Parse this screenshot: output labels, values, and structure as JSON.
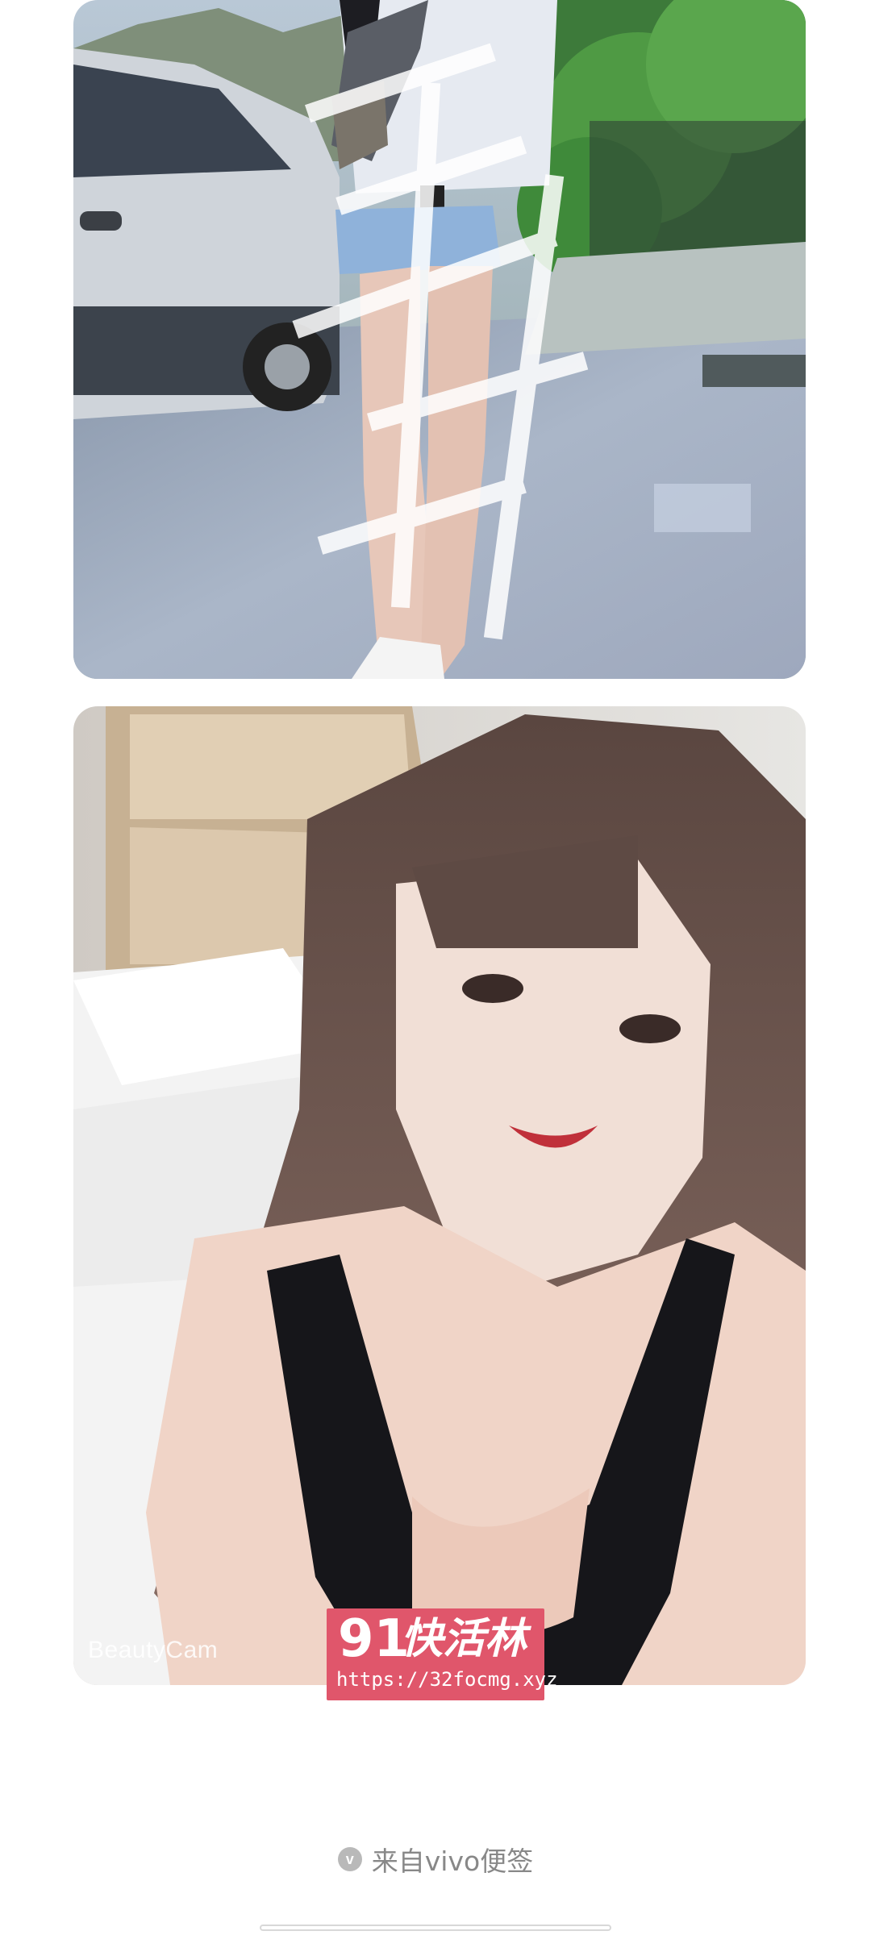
{
  "photos": [
    {
      "id": "street-photo",
      "watermark": ""
    },
    {
      "id": "selfie-photo",
      "watermark": "BeautyCam"
    }
  ],
  "ad_banner": {
    "brand_number": "91",
    "brand_name": "快活林",
    "url": "https://32focmg.xyz",
    "color": "#e0566b"
  },
  "footer": {
    "icon": "vivo-logo-icon",
    "icon_letter": "v",
    "source_text": "来自vivo便签"
  }
}
